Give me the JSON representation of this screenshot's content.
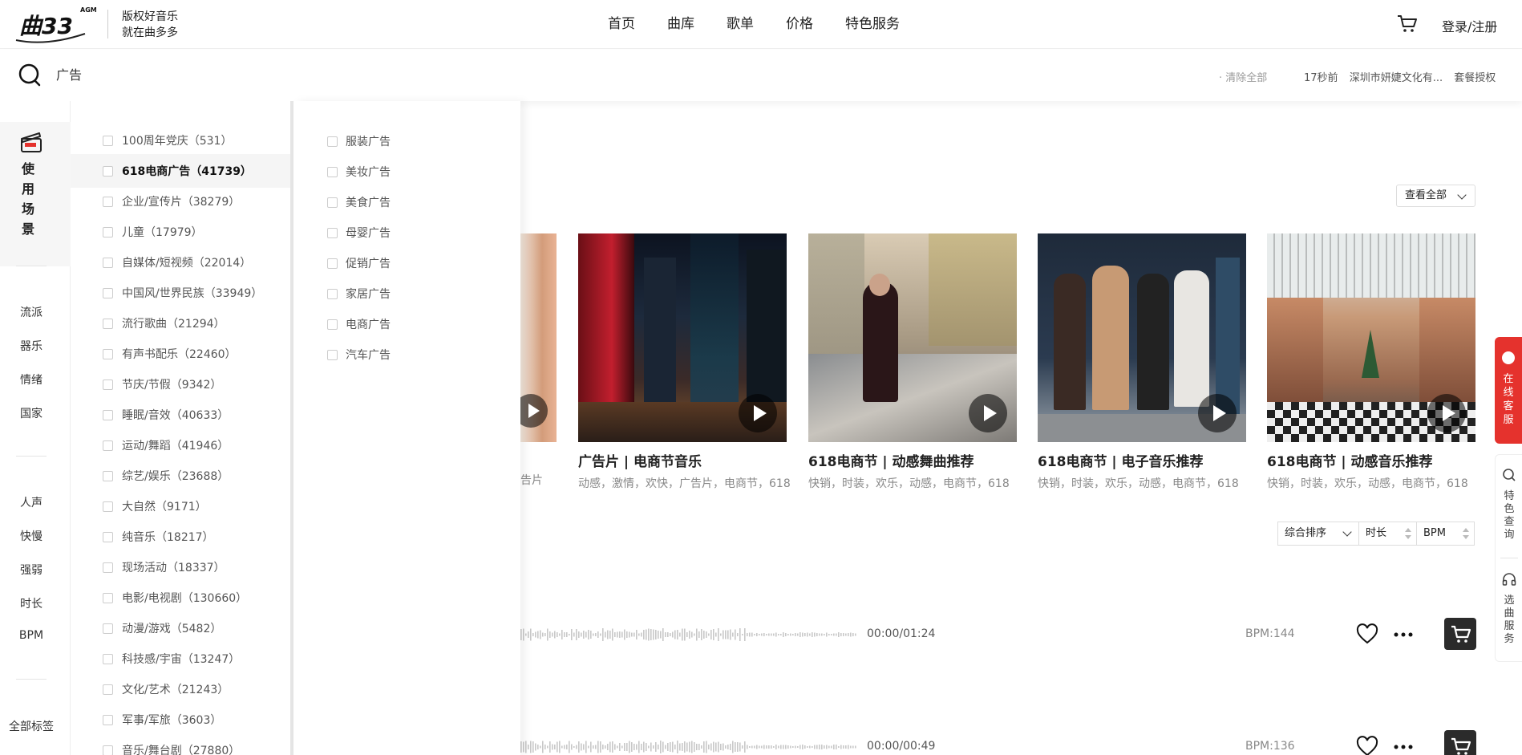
{
  "header": {
    "logo_text": "曲多多",
    "logo_badge": "AGM",
    "slogan_line1": "版权好音乐",
    "slogan_line2": "就在曲多多",
    "nav": [
      "首页",
      "曲库",
      "歌单",
      "价格",
      "特色服务"
    ],
    "login": "登录/注册"
  },
  "search": {
    "value": "广告",
    "clear_all": "· 清除全部",
    "recent": [
      "17秒前",
      "深圳市妍婕文化有...",
      "套餐授权"
    ]
  },
  "rail": {
    "active_title": "使用场景",
    "group1": [
      "流派",
      "器乐",
      "情绪",
      "国家"
    ],
    "group2": [
      "人声",
      "快慢",
      "强弱",
      "时长",
      "BPM"
    ],
    "all_tags": "全部标签"
  },
  "categories": [
    "100周年党庆（531）",
    "618电商广告（41739）",
    "企业/宣传片（38279）",
    "儿童（17979）",
    "自媒体/短视频（22014）",
    "中国风/世界民族（33949）",
    "流行歌曲（21294）",
    "有声书配乐（22460）",
    "节庆/节假（9342）",
    "睡眠/音效（40633）",
    "运动/舞蹈（41946）",
    "综艺/娱乐（23688）",
    "大自然（9171）",
    "纯音乐（18217）",
    "现场活动（18337）",
    "电影/电视剧（130660）",
    "动漫/游戏（5482）",
    "科技感/宇宙（13247）",
    "文化/艺术（21243）",
    "军事/军旅（3603）",
    "音乐/舞台剧（27880）"
  ],
  "selected_category_index": 1,
  "subcategories": [
    "服装广告",
    "美妆广告",
    "美食广告",
    "母婴广告",
    "促销广告",
    "家居广告",
    "电商广告",
    "汽车广告"
  ],
  "main": {
    "view_all": "查看全部",
    "partial_tag": "告片",
    "cards": [
      {
        "title": "广告片 | 电商节音乐",
        "tags": "动感，激情，欢快，广告片，电商节，618"
      },
      {
        "title": "618电商节 | 动感舞曲推荐",
        "tags": "快销，时装，欢乐，动感，电商节，618"
      },
      {
        "title": "618电商节 | 电子音乐推荐",
        "tags": "快销，时装，欢乐，动感，电商节，618"
      },
      {
        "title": "618电商节 | 动感音乐推荐",
        "tags": "快销，时装，欢乐，动感，电商节，618"
      }
    ],
    "sort": {
      "combined": "综合排序",
      "duration": "时长",
      "bpm": "BPM"
    },
    "tracks": [
      {
        "time": "00:00/01:24",
        "bpm": "BPM:144"
      },
      {
        "time": "00:00/00:49",
        "bpm": "BPM:136"
      }
    ]
  },
  "float": {
    "service": "在线客服",
    "search": "特色查询",
    "pick": "选曲服务"
  },
  "colors": {
    "accent": "#e5322d",
    "dark": "#2b2b2b"
  }
}
